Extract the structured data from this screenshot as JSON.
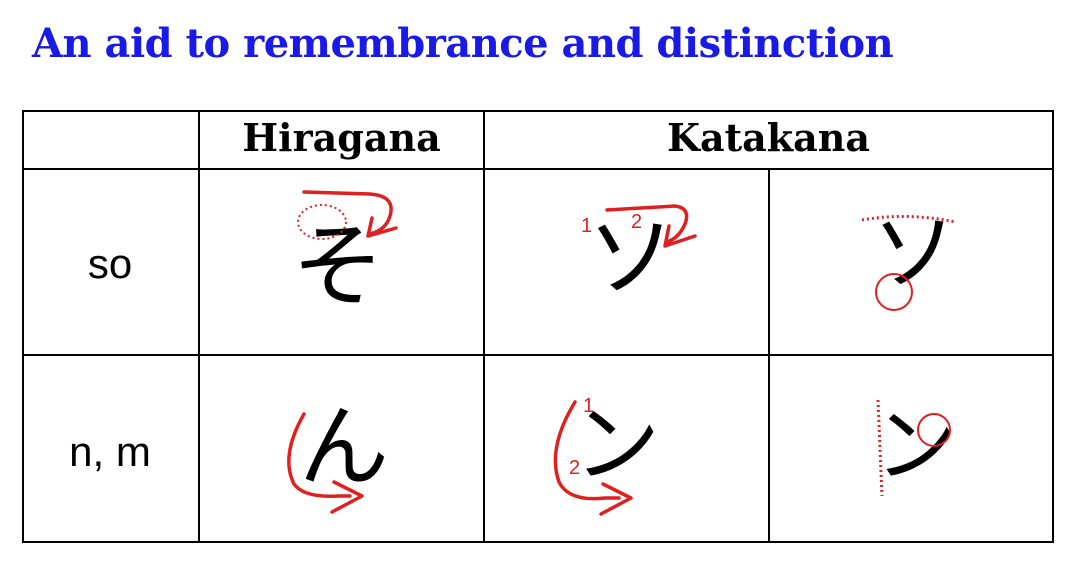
{
  "title": "An aid to remembrance and distinction",
  "table": {
    "headers": [
      "",
      "Hiragana",
      "Katakana"
    ],
    "rows": [
      {
        "label": "so",
        "hiragana": "そ",
        "katakana": "ソ",
        "stroke_numbers": [
          "1",
          "2"
        ]
      },
      {
        "label": "n, m",
        "hiragana": "ん",
        "katakana": "ン",
        "stroke_numbers": [
          "1",
          "2"
        ]
      }
    ]
  },
  "colors": {
    "title": "#1a1ae6",
    "annotation": "#e02020",
    "ink": "#000000"
  }
}
